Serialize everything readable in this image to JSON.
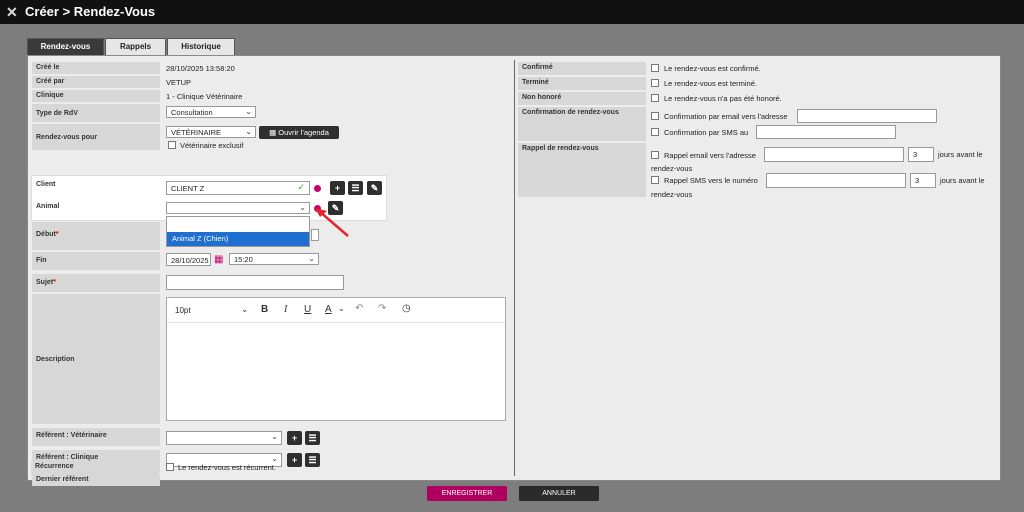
{
  "window": {
    "close_glyph": "✕",
    "title": "Créer > Rendez-Vous"
  },
  "tabs": [
    "Rendez-vous",
    "Rappels",
    "Historique"
  ],
  "left": {
    "cree_le": {
      "label": "Créé le",
      "value": "28/10/2025 13:58:20"
    },
    "cree_par": {
      "label": "Créé par",
      "value": "VETUP"
    },
    "clinique": {
      "label": "Clinique",
      "value": "1 - Clinique Vétérinaire"
    },
    "type_rdv": {
      "label": "Type de RdV",
      "value": "Consultation"
    },
    "rdv_pour": {
      "label": "Rendez-vous pour",
      "value": "VÉTÉRINAIRE",
      "agenda_button": "Ouvrir l'agenda",
      "exclusive_checkbox": "Vétérinaire exclusif"
    },
    "client": {
      "label": "Client",
      "value": "CLIENT Z",
      "check_glyph": "✓"
    },
    "animal": {
      "label": "Animal",
      "value": "",
      "dropdown_option": "Animal Z (Chien)"
    },
    "debut": {
      "label": "Début",
      "required": "*"
    },
    "fin": {
      "label": "Fin",
      "date": "28/10/2025",
      "time": "15:20"
    },
    "sujet": {
      "label": "Sujet",
      "required": "*",
      "value": ""
    },
    "description": {
      "label": "Description",
      "font_size": "10pt"
    },
    "ref_vet": {
      "label": "Référent : Vétérinaire"
    },
    "ref_clinique": {
      "label": "Référent : Clinique"
    },
    "dernier_referent": {
      "label": "Dernier référent"
    },
    "recurrence": {
      "label": "Récurrence",
      "checkbox": "Le rendez-vous est récurrent."
    }
  },
  "right": {
    "confirme": {
      "label": "Confirmé",
      "checkbox": "Le rendez-vous est confirmé."
    },
    "termine": {
      "label": "Terminé",
      "checkbox": "Le rendez-vous est terminé."
    },
    "non_honore": {
      "label": "Non honoré",
      "checkbox": "Le rendez-vous n'a pas été honoré."
    },
    "confirmation": {
      "label": "Confirmation de rendez-vous",
      "email": "Confirmation par email vers l'adresse",
      "sms": "Confirmation par SMS au"
    },
    "rappel": {
      "label": "Rappel de rendez-vous",
      "email": "Rappel email vers l'adresse",
      "email_days": "3",
      "email_suffix_1": "jours avant le",
      "email_suffix_2": "rendez-vous",
      "sms": "Rappel SMS vers le numéro",
      "sms_days": "3",
      "sms_suffix_1": "jours avant le",
      "sms_suffix_2": "rendez-vous"
    }
  },
  "footer": {
    "save": "ENREGISTRER",
    "cancel": "ANNULER"
  },
  "colors": {
    "accent": "#c3006b",
    "dark": "#2f2f2f",
    "selected": "#1f6fd1"
  }
}
